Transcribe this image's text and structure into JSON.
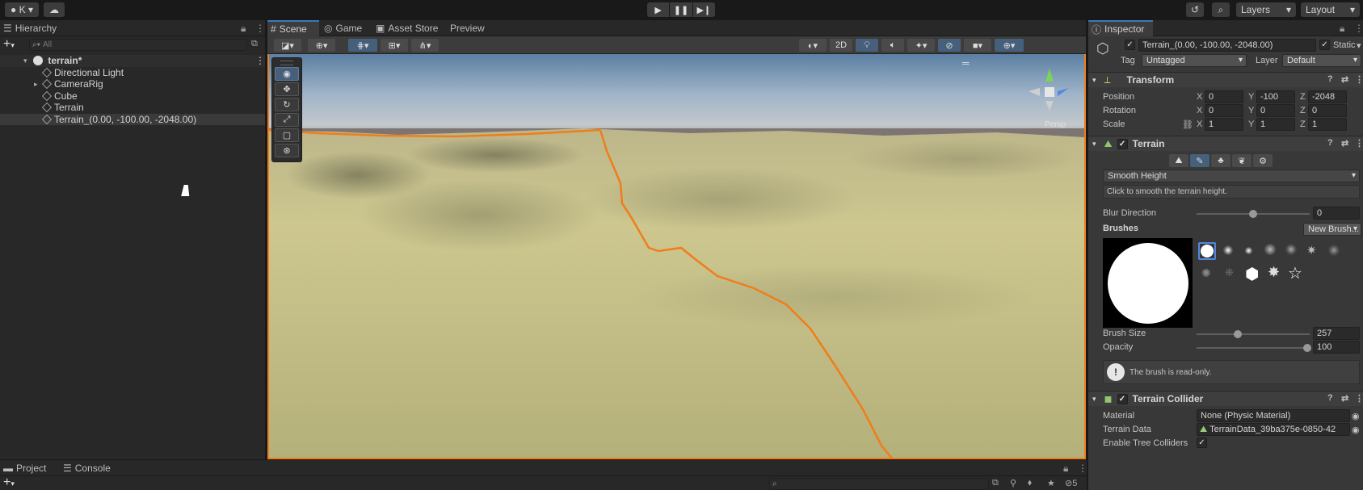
{
  "toolbar": {
    "account_label": "K",
    "layers_label": "Layers",
    "layout_label": "Layout"
  },
  "hierarchy": {
    "tab_label": "Hierarchy",
    "search_placeholder": "All",
    "scene_name": "terrain*",
    "items": [
      {
        "label": "Directional Light"
      },
      {
        "label": "CameraRig"
      },
      {
        "label": "Cube"
      },
      {
        "label": "Terrain"
      },
      {
        "label": "Terrain_(0.00, -100.00, -2048.00)"
      }
    ]
  },
  "scene_tabs": [
    {
      "label": "Scene"
    },
    {
      "label": "Game"
    },
    {
      "label": "Asset Store"
    },
    {
      "label": "Preview"
    }
  ],
  "scene_toolbar": {
    "mode_2d_label": "2D",
    "persp_label": "Persp"
  },
  "inspector": {
    "tab_label": "Inspector",
    "object_name": "Terrain_(0.00, -100.00, -2048.00)",
    "static_label": "Static",
    "tag_label": "Tag",
    "tag_value": "Untagged",
    "layer_label": "Layer",
    "layer_value": "Default",
    "transform": {
      "title": "Transform",
      "position_label": "Position",
      "rotation_label": "Rotation",
      "scale_label": "Scale",
      "position": {
        "x": "0",
        "y": "-100",
        "z": "-2048"
      },
      "rotation": {
        "x": "0",
        "y": "0",
        "z": "0"
      },
      "scale": {
        "x": "1",
        "y": "1",
        "z": "1"
      }
    },
    "terrain": {
      "title": "Terrain",
      "tool_selected": "Smooth Height",
      "tool_help": "Click to smooth the terrain height.",
      "blur_direction_label": "Blur Direction",
      "blur_direction_value": "0",
      "brushes_label": "Brushes",
      "new_brush_label": "New Brush...",
      "brush_size_label": "Brush Size",
      "brush_size_value": "257",
      "opacity_label": "Opacity",
      "opacity_value": "100",
      "readonly_note": "The brush is read-only."
    },
    "collider": {
      "title": "Terrain Collider",
      "material_label": "Material",
      "material_value": "None (Physic Material)",
      "terrain_data_label": "Terrain Data",
      "terrain_data_value": "TerrainData_39ba375e-0850-42",
      "enable_tree_label": "Enable Tree Colliders"
    }
  },
  "bottom": {
    "project_tab": "Project",
    "console_tab": "Console",
    "hidden_count": "5"
  },
  "colors": {
    "accent_blue": "#3a79bb",
    "selection_orange": "#f07d1a",
    "panel_bg": "#383838"
  }
}
